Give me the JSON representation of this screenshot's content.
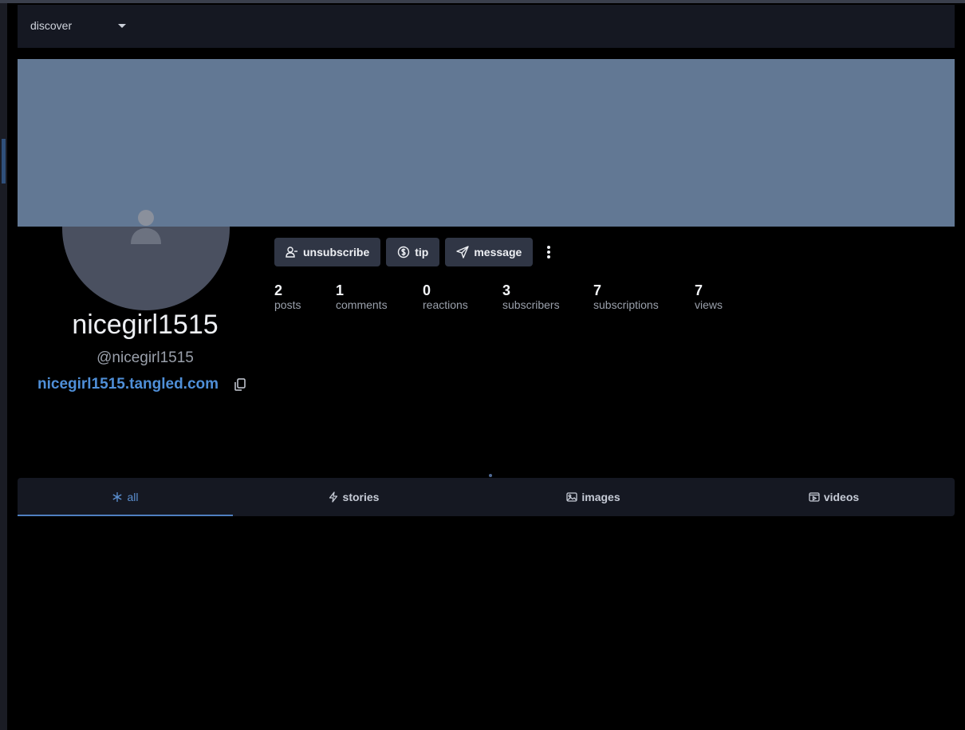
{
  "topbar": {
    "dropdown_label": "discover"
  },
  "profile": {
    "display_name": "nicegirl1515",
    "handle": "@nicegirl1515",
    "site": "nicegirl1515.tangled.com"
  },
  "actions": {
    "unsubscribe": "unsubscribe",
    "tip": "tip",
    "message": "message"
  },
  "stats": [
    {
      "value": "2",
      "label": "posts"
    },
    {
      "value": "1",
      "label": "comments"
    },
    {
      "value": "0",
      "label": "reactions"
    },
    {
      "value": "3",
      "label": "subscribers"
    },
    {
      "value": "7",
      "label": "subscriptions"
    },
    {
      "value": "7",
      "label": "views"
    }
  ],
  "tabs": [
    {
      "label": "all",
      "icon": "asterisk-icon",
      "active": true
    },
    {
      "label": "stories",
      "icon": "lightning-icon",
      "active": false
    },
    {
      "label": "images",
      "icon": "image-icon",
      "active": false
    },
    {
      "label": "videos",
      "icon": "video-icon",
      "active": false
    }
  ],
  "colors": {
    "background": "#000000",
    "panel": "#151822",
    "banner": "#627894",
    "accent": "#4f8fd8",
    "button": "#303645"
  }
}
